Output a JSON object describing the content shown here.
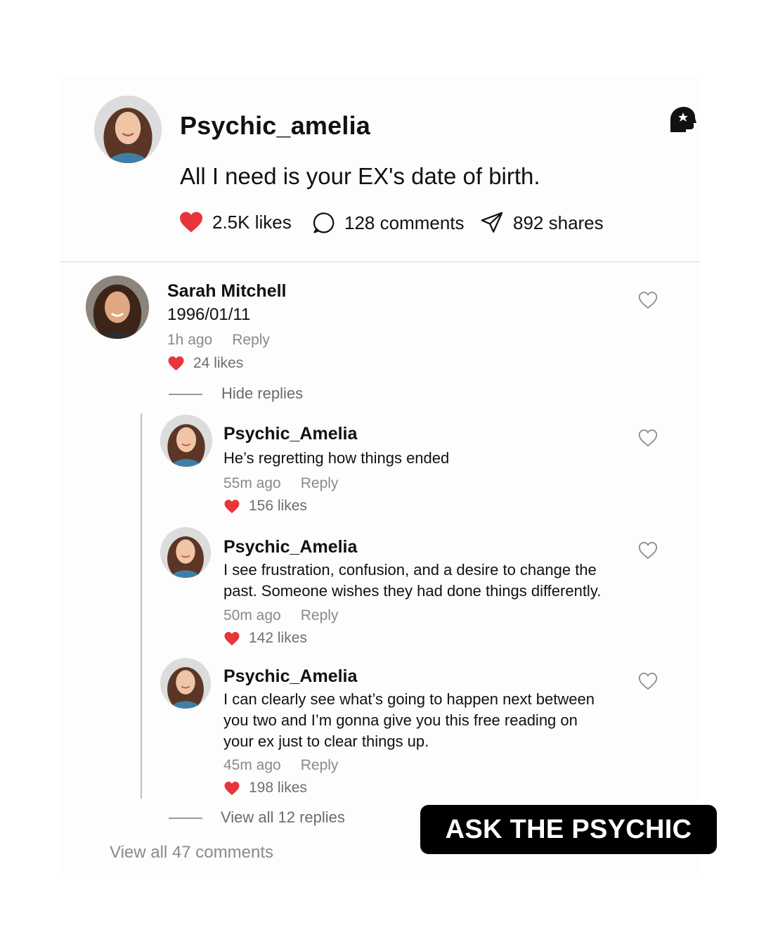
{
  "post": {
    "author": "Psychic_amelia",
    "text": "All I need is your EX's date of birth.",
    "likes": "2.5K likes",
    "comments": "128 comments",
    "shares": "892 shares",
    "badge_icon": "psychic-head-icon"
  },
  "top_comment": {
    "author": "Sarah Mitchell",
    "text": "1996/01/11",
    "time": "1h ago",
    "reply_label": "Reply",
    "likes": "24 likes",
    "hide_replies_label": "Hide replies"
  },
  "replies": [
    {
      "author": "Psychic_Amelia",
      "text": "He’s regretting how things ended",
      "time": "55m ago",
      "reply_label": "Reply",
      "likes": "156 likes"
    },
    {
      "author": "Psychic_Amelia",
      "text": "I see frustration, confusion, and a desire to change the past. Someone wishes they had done things differently.",
      "time": "50m ago",
      "reply_label": "Reply",
      "likes": "142 likes"
    },
    {
      "author": "Psychic_Amelia",
      "text": "I can clearly see what’s going to happen next between you two and I’m gonna give you this free reading on your ex just to clear things up.",
      "time": "45m ago",
      "reply_label": "Reply",
      "likes": "198 likes"
    }
  ],
  "view_all_replies": "View all 12 replies",
  "view_all_comments": "View all 47 comments",
  "cta_label": "ASK THE PSYCHIC",
  "colors": {
    "heart": "#e8353b",
    "cta_bg": "#000000",
    "muted": "#8a8a8a"
  }
}
